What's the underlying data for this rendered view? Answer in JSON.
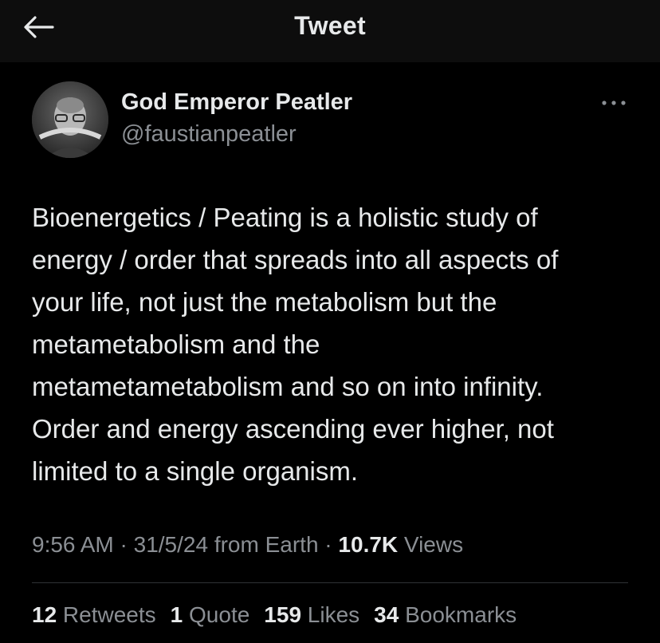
{
  "header": {
    "title": "Tweet",
    "back_icon": "arrow-left-icon"
  },
  "author": {
    "display_name": "God Emperor Peatler",
    "handle": "@faustianpeatler",
    "avatar": "avatar-photo"
  },
  "more_icon": "ellipsis-icon",
  "tweet": {
    "lines": [
      "Bioenergetics / Peating is a holistic study of",
      "energy / order that spreads into all aspects of",
      "your life, not just the metabolism but the",
      "metametabolism and the",
      "metametametabolism and so on into infinity.",
      "Order and energy ascending ever higher, not",
      "limited to a single organism."
    ]
  },
  "meta": {
    "time": "9:56 AM",
    "sep1": " · ",
    "date": "31/5/24",
    "source": " from Earth",
    "sep2": " · ",
    "views_count": "10.7K",
    "views_label": " Views"
  },
  "stats": {
    "retweets_count": "12",
    "retweets_label": " Retweets",
    "quotes_count": "1",
    "quotes_label": " Quote",
    "likes_count": "159",
    "likes_label": " Likes",
    "bookmarks_count": "34",
    "bookmarks_label": " Bookmarks"
  },
  "colors": {
    "background": "#000000",
    "header_bg": "#0d0d0d",
    "primary_text": "#e7e9ea",
    "secondary_text": "#8b8f94",
    "divider": "#2f3336"
  }
}
